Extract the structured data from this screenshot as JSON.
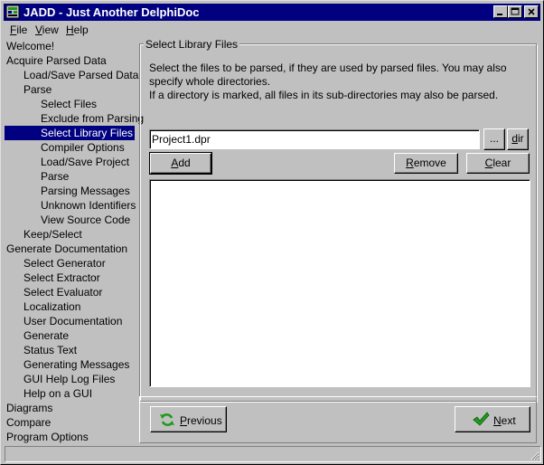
{
  "window": {
    "title": "JADD - Just Another DelphiDoc"
  },
  "menu": [
    {
      "pre": "",
      "accel": "F",
      "post": "ile"
    },
    {
      "pre": "",
      "accel": "V",
      "post": "iew"
    },
    {
      "pre": "",
      "accel": "H",
      "post": "elp"
    }
  ],
  "nav": [
    {
      "label": "Welcome!",
      "level": 0
    },
    {
      "label": "Acquire Parsed Data",
      "level": 0
    },
    {
      "label": "Load/Save Parsed Data",
      "level": 1
    },
    {
      "label": "Parse",
      "level": 1
    },
    {
      "label": "Select Files",
      "level": 2
    },
    {
      "label": "Exclude from Parsing",
      "level": 2
    },
    {
      "label": "Select Library Files",
      "level": 2,
      "selected": true
    },
    {
      "label": "Compiler Options",
      "level": 2
    },
    {
      "label": "Load/Save Project",
      "level": 2
    },
    {
      "label": "Parse",
      "level": 2
    },
    {
      "label": "Parsing Messages",
      "level": 2
    },
    {
      "label": "Unknown Identifiers",
      "level": 2
    },
    {
      "label": "View Source Code",
      "level": 2
    },
    {
      "label": "Keep/Select",
      "level": 1
    },
    {
      "label": "Generate Documentation",
      "level": 0
    },
    {
      "label": "Select Generator",
      "level": 1
    },
    {
      "label": "Select Extractor",
      "level": 1
    },
    {
      "label": "Select Evaluator",
      "level": 1
    },
    {
      "label": "Localization",
      "level": 1
    },
    {
      "label": "User Documentation",
      "level": 1
    },
    {
      "label": "Generate",
      "level": 1
    },
    {
      "label": "Status Text",
      "level": 1
    },
    {
      "label": "Generating Messages",
      "level": 1
    },
    {
      "label": "GUI Help Log Files",
      "level": 1
    },
    {
      "label": "Help on a GUI",
      "level": 1
    },
    {
      "label": "Diagrams",
      "level": 0
    },
    {
      "label": "Compare",
      "level": 0
    },
    {
      "label": "Program Options",
      "level": 0
    }
  ],
  "page": {
    "title": "Select Library Files",
    "desc_line1": "Select the files to be parsed, if they are used by parsed files. You may also specify whole directories.",
    "desc_line2": "If a directory is marked, all files in its sub-directories may also be parsed.",
    "file_value": "Project1.dpr",
    "browse_label": "...",
    "dir": {
      "pre": "",
      "accel": "d",
      "post": "ir"
    },
    "add": {
      "pre": "",
      "accel": "A",
      "post": "dd"
    },
    "remove": {
      "pre": "",
      "accel": "R",
      "post": "emove"
    },
    "clear": {
      "pre": "",
      "accel": "C",
      "post": "lear"
    }
  },
  "footer": {
    "previous": {
      "pre": "",
      "accel": "P",
      "post": "revious"
    },
    "next": {
      "pre": "",
      "accel": "N",
      "post": "ext"
    }
  },
  "icons": {
    "previous": "refresh-arrows-icon",
    "next": "checkmark-icon",
    "app": "jadd-app-icon"
  },
  "colors": {
    "selection": "#000080",
    "titlebar": "#000080",
    "face": "#c0c0c0",
    "next_check": "#1f9a1f",
    "previous_arrows": "#1f9a1f"
  }
}
